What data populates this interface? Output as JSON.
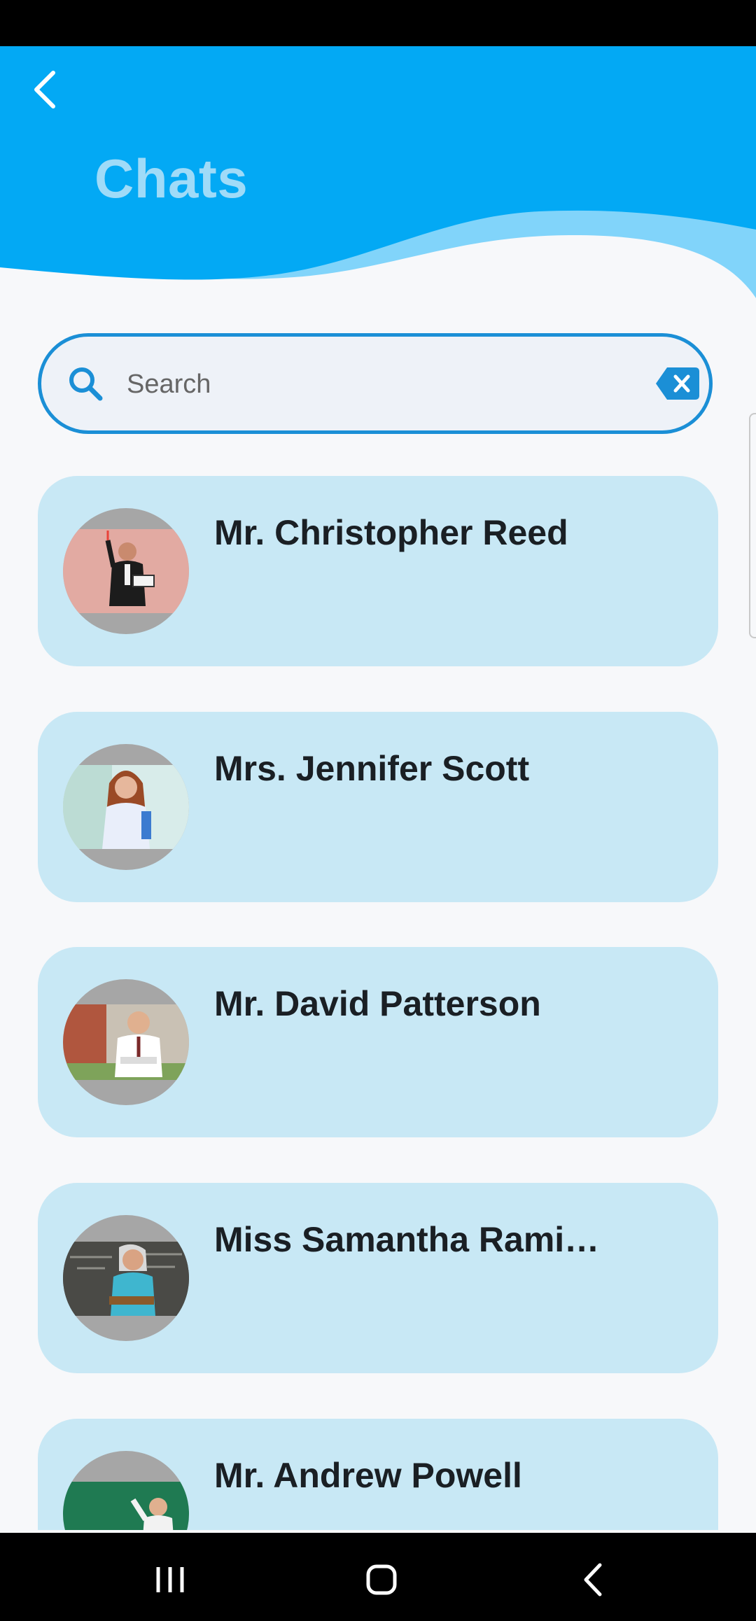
{
  "header": {
    "title": "Chats",
    "back_icon": "chevron-left-icon"
  },
  "colors": {
    "header_blue": "#03a9f4",
    "wave_light": "#81d4fa",
    "card_bg": "#c8e8f5",
    "search_border": "#1b8fd6"
  },
  "search": {
    "placeholder": "Search",
    "value": "",
    "search_icon": "search-icon",
    "clear_icon": "backspace-clear-icon"
  },
  "chats": [
    {
      "name": "Mr. Christopher Reed"
    },
    {
      "name": "Mrs. Jennifer Scott"
    },
    {
      "name": "Mr. David Patterson"
    },
    {
      "name": "Miss Samantha Rami…"
    },
    {
      "name": "Mr. Andrew Powell"
    }
  ],
  "navbar": {
    "recents_icon": "recents-icon",
    "home_icon": "home-icon",
    "back_icon": "back-icon"
  }
}
